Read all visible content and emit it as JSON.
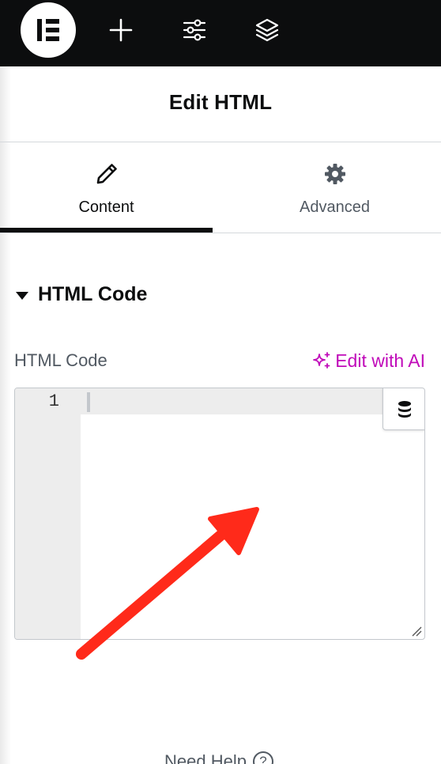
{
  "topbar": {
    "icons": [
      "elementor-logo",
      "add-element-icon",
      "site-settings-icon",
      "structure-layers-icon"
    ]
  },
  "panel": {
    "title": "Edit HTML"
  },
  "tabs": [
    {
      "label": "Content",
      "icon": "pencil-icon",
      "active": true
    },
    {
      "label": "Advanced",
      "icon": "gear-icon",
      "active": false
    }
  ],
  "section": {
    "title": "HTML Code",
    "expanded": true
  },
  "field": {
    "label": "HTML Code",
    "ai_button_label": "Edit with AI",
    "editor": {
      "line_numbers": [
        "1"
      ],
      "value": ""
    }
  },
  "footer": {
    "need_help_label": "Need Help",
    "help_symbol": "?"
  },
  "colors": {
    "topbar_bg": "#0c0d0e",
    "ai_accent": "#c00bb9",
    "annotation_arrow": "#ff2a1a"
  }
}
